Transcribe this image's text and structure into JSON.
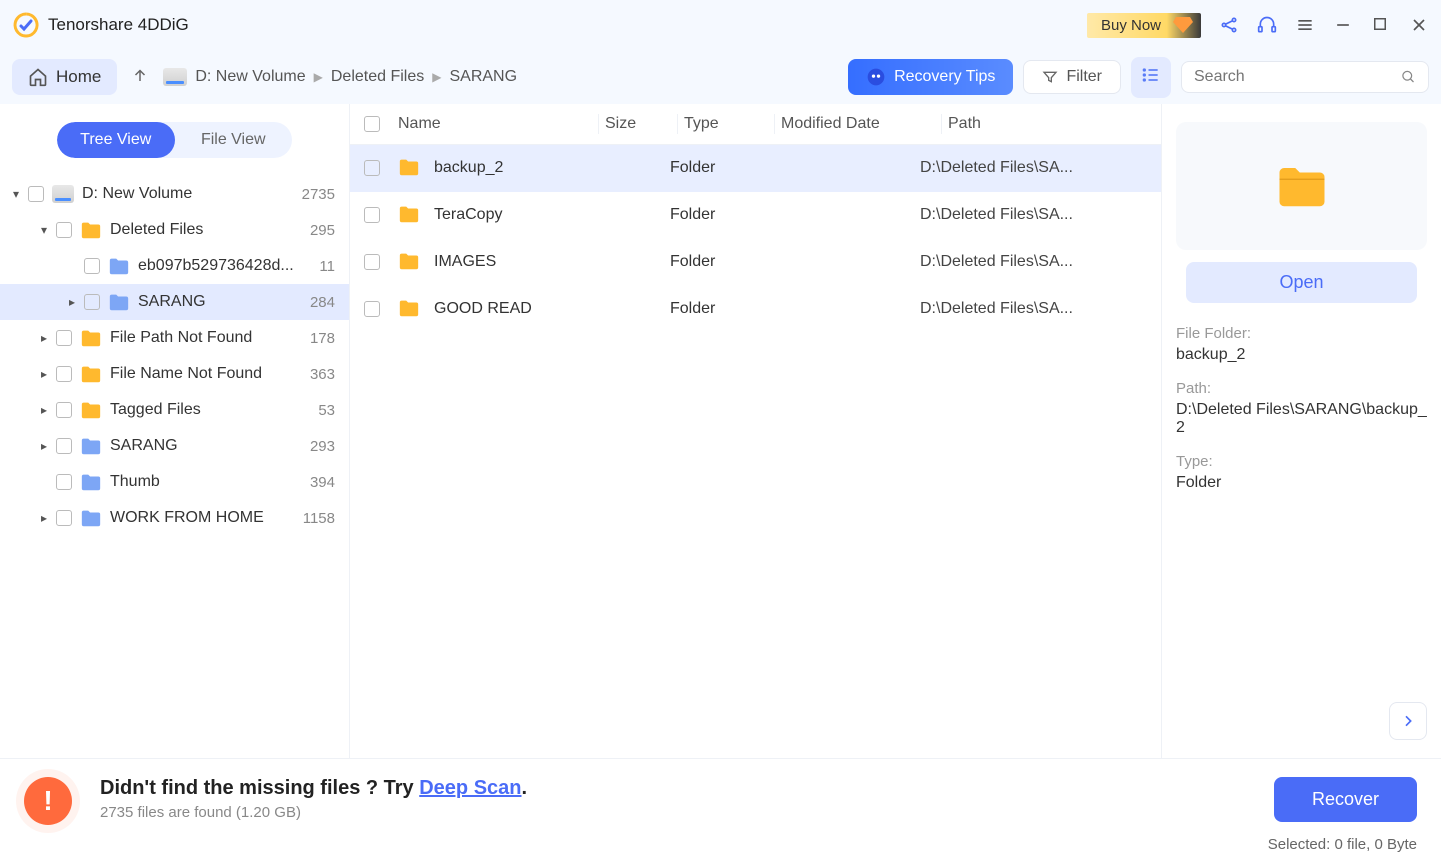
{
  "app": {
    "title": "Tenorshare 4DDiG",
    "buy_now": "Buy Now"
  },
  "toolbar": {
    "home": "Home",
    "breadcrumb": [
      "D: New Volume",
      "Deleted Files",
      "SARANG"
    ],
    "recovery_tips": "Recovery Tips",
    "filter": "Filter",
    "search_placeholder": "Search"
  },
  "view_tabs": {
    "tree": "Tree View",
    "file": "File View"
  },
  "tree": [
    {
      "depth": 0,
      "expander": "▾",
      "icon": "disk",
      "label": "D: New Volume",
      "count": "2735"
    },
    {
      "depth": 1,
      "expander": "▾",
      "icon": "folder-yellow",
      "label": "Deleted Files",
      "count": "295"
    },
    {
      "depth": 2,
      "expander": "",
      "icon": "folder-blue",
      "label": "eb097b529736428d...",
      "count": "11"
    },
    {
      "depth": 2,
      "expander": "▸",
      "icon": "folder-blue",
      "label": "SARANG",
      "count": "284",
      "selected": true
    },
    {
      "depth": 1,
      "expander": "▸",
      "icon": "folder-yellow",
      "label": "File Path Not Found",
      "count": "178"
    },
    {
      "depth": 1,
      "expander": "▸",
      "icon": "folder-yellow",
      "label": "File Name Not Found",
      "count": "363"
    },
    {
      "depth": 1,
      "expander": "▸",
      "icon": "folder-yellow",
      "label": "Tagged Files",
      "count": "53"
    },
    {
      "depth": 1,
      "expander": "▸",
      "icon": "folder-blue",
      "label": "SARANG",
      "count": "293"
    },
    {
      "depth": 1,
      "expander": "",
      "icon": "folder-blue",
      "label": "Thumb",
      "count": "394"
    },
    {
      "depth": 1,
      "expander": "▸",
      "icon": "folder-blue",
      "label": "WORK FROM HOME",
      "count": "1158"
    }
  ],
  "table": {
    "headers": {
      "name": "Name",
      "size": "Size",
      "type": "Type",
      "mod": "Modified Date",
      "path": "Path"
    },
    "rows": [
      {
        "name": "backup_2",
        "type": "Folder",
        "path": "D:\\Deleted Files\\SA...",
        "selected": true
      },
      {
        "name": "TeraCopy",
        "type": "Folder",
        "path": "D:\\Deleted Files\\SA..."
      },
      {
        "name": "IMAGES",
        "type": "Folder",
        "path": "D:\\Deleted Files\\SA..."
      },
      {
        "name": "GOOD READ",
        "type": "Folder",
        "path": "D:\\Deleted Files\\SA..."
      }
    ]
  },
  "preview": {
    "open": "Open",
    "fields": {
      "folder_label": "File Folder:",
      "folder_value": "backup_2",
      "path_label": "Path:",
      "path_value": "D:\\Deleted Files\\SARANG\\backup_2",
      "type_label": "Type:",
      "type_value": "Folder"
    }
  },
  "footer": {
    "headline_a": "Didn't find the missing files ? Try ",
    "headline_link": "Deep Scan",
    "headline_b": ".",
    "sub": "2735 files are found (1.20 GB)",
    "recover": "Recover",
    "selected": "Selected: 0 file, 0 Byte"
  }
}
